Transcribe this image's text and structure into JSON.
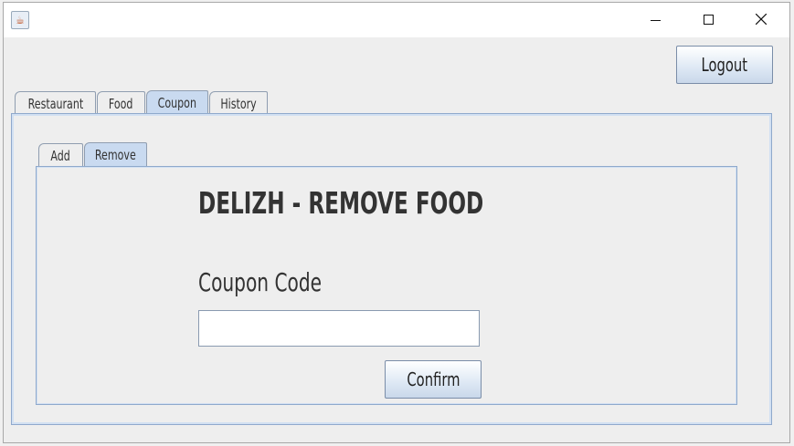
{
  "window": {
    "icon": "java-cup-icon",
    "controls": {
      "minimize": "—",
      "maximize": "☐",
      "close": "✕"
    }
  },
  "header": {
    "logout_label": "Logout"
  },
  "main_tabs": [
    {
      "label": "Restaurant",
      "selected": false
    },
    {
      "label": "Food",
      "selected": false
    },
    {
      "label": "Coupon",
      "selected": true
    },
    {
      "label": "History",
      "selected": false
    }
  ],
  "sub_tabs": [
    {
      "label": "Add",
      "selected": false
    },
    {
      "label": "Remove",
      "selected": true
    }
  ],
  "form": {
    "title": "DELIZH - REMOVE FOOD",
    "coupon_label": "Coupon Code",
    "coupon_value": "",
    "confirm_label": "Confirm"
  },
  "colors": {
    "tab_selected": "#c9daf0",
    "panel_border": "#8fa9cc"
  }
}
